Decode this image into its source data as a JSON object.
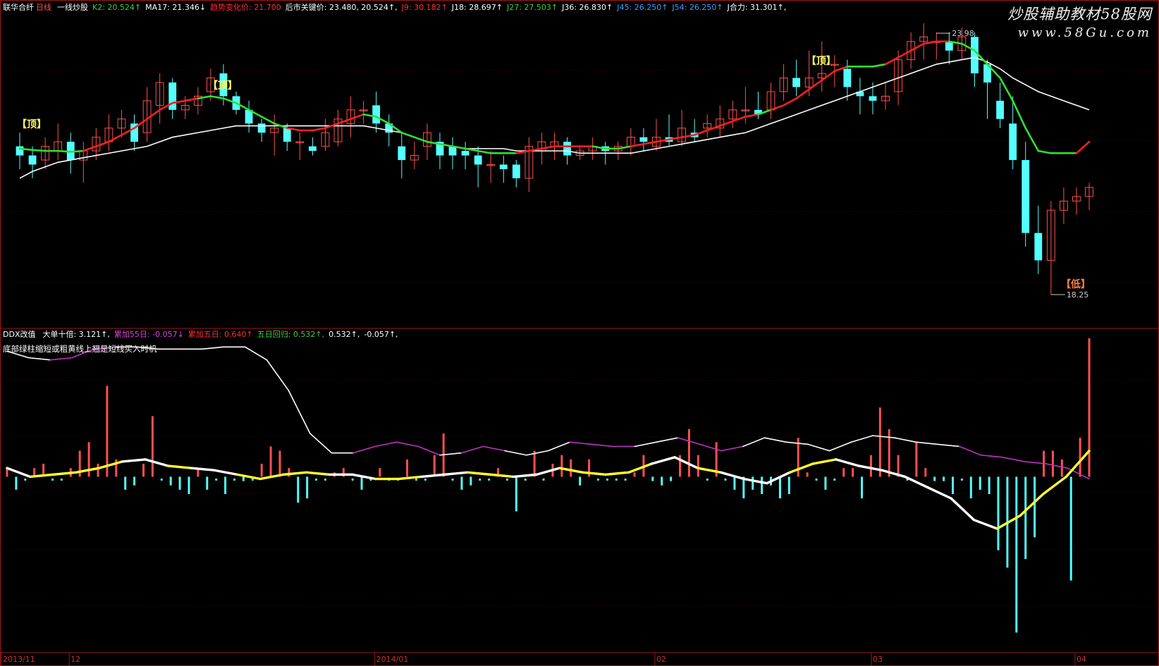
{
  "header": {
    "stock_name": "联华合纤",
    "period": "日线",
    "indicator_name": "一线炒股",
    "items": [
      {
        "label": "K2:",
        "value": "20.524↑",
        "color": "#3ecf3e"
      },
      {
        "label": "MA17:",
        "value": "21.346↓",
        "color": "#ffffff"
      },
      {
        "label": "趋势变化价:",
        "value": "21.700",
        "color": "#ff3030"
      },
      {
        "label": "后市关键价:",
        "value": "23.480, 20.524↑,",
        "color": "#ffffff"
      },
      {
        "label": "J9:",
        "value": "30.182↑",
        "color": "#ff3030"
      },
      {
        "label": "J18:",
        "value": "28.697↑",
        "color": "#ffffff"
      },
      {
        "label": "J27:",
        "value": "27.503↑",
        "color": "#3ecf3e"
      },
      {
        "label": "J36:",
        "value": "26.830↑",
        "color": "#ffffff"
      },
      {
        "label": "J45:",
        "value": "26.250↑",
        "color": "#3aa0ff"
      },
      {
        "label": "J54:",
        "value": "26.250↑",
        "color": "#3aa0ff"
      },
      {
        "label": "J合力:",
        "value": "31.301↑,",
        "color": "#ffffff"
      }
    ]
  },
  "sub_header": {
    "indicator_name": "DDX改值",
    "items": [
      {
        "label": "大单十倍:",
        "value": "3.121↑,",
        "color": "#ffffff"
      },
      {
        "label": "累加55日:",
        "value": "-0.057↓",
        "color": "#e040e0"
      },
      {
        "label": "累加五日:",
        "value": "0.640↑",
        "color": "#ff3030"
      },
      {
        "label": "五日回归:",
        "value": "0.532↑,",
        "color": "#3ecf3e"
      },
      {
        "label": "",
        "value": "0.532↑,",
        "color": "#ffffff"
      },
      {
        "label": "",
        "value": "-0.057↑,",
        "color": "#ffffff"
      }
    ],
    "hint": "底部绿柱缩短或粗黄线上翘是短线买入时机"
  },
  "watermark": {
    "line1": "炒股辅助教材58股网",
    "line2": "www.58Gu.com"
  },
  "tags": [
    {
      "text": "【顶】",
      "color": "#ffff66",
      "price": 22.0,
      "index": 1
    },
    {
      "text": "【顶】",
      "color": "#ffff66",
      "price": 22.85,
      "index": 16
    },
    {
      "text": "【顶】",
      "color": "#ffff66",
      "price": 23.4,
      "index": 63
    },
    {
      "text": "【低】",
      "color": "#ff8040",
      "price": 18.5,
      "index": 83
    }
  ],
  "price_marks": [
    {
      "text": "23.98",
      "index": 72,
      "price": 23.98
    },
    {
      "text": "18.25",
      "index": 81,
      "price": 18.25
    }
  ],
  "dates": [
    {
      "text": "2013/11",
      "index": 0
    },
    {
      "text": "12",
      "index": 4
    },
    {
      "text": "2014/01",
      "index": 28
    },
    {
      "text": "02",
      "index": 50
    },
    {
      "text": "03",
      "index": 67
    },
    {
      "text": "04",
      "index": 83
    }
  ],
  "colors": {
    "up": "#ff5050",
    "down": "#54ffff",
    "ma_white": "#ffffff",
    "k_red": "#ff2020",
    "k_green": "#30e030",
    "ddx_pos": "#ff5050",
    "ddx_neg": "#54ffff",
    "yellow": "#ffff30",
    "magenta": "#c030c0",
    "frame": "#a01818"
  },
  "chart_data": [
    {
      "type": "candlestick",
      "title": "",
      "ylim": [
        17.6,
        24.4
      ],
      "candles": [
        [
          21.5,
          21.3,
          21.8,
          21.0
        ],
        [
          21.3,
          21.1,
          21.5,
          20.8
        ],
        [
          21.2,
          21.5,
          21.7,
          21.0
        ],
        [
          21.4,
          21.6,
          22.0,
          21.2
        ],
        [
          21.6,
          21.2,
          21.8,
          20.9
        ],
        [
          21.2,
          21.4,
          21.6,
          20.7
        ],
        [
          21.4,
          21.7,
          21.9,
          21.2
        ],
        [
          21.6,
          21.9,
          22.2,
          21.4
        ],
        [
          21.9,
          22.1,
          22.3,
          21.7
        ],
        [
          22.0,
          21.6,
          22.2,
          21.4
        ],
        [
          21.8,
          22.5,
          22.8,
          21.6
        ],
        [
          22.4,
          22.9,
          23.1,
          22.0
        ],
        [
          22.9,
          22.3,
          23.0,
          22.1
        ],
        [
          22.3,
          22.4,
          22.6,
          22.1
        ],
        [
          22.4,
          22.6,
          22.8,
          22.2
        ],
        [
          22.7,
          23.0,
          23.2,
          22.5
        ],
        [
          23.1,
          22.6,
          23.3,
          22.4
        ],
        [
          22.6,
          22.3,
          22.7,
          22.2
        ],
        [
          22.3,
          22.0,
          22.5,
          21.8
        ],
        [
          22.0,
          21.8,
          22.1,
          21.6
        ],
        [
          21.8,
          21.9,
          22.2,
          21.3
        ],
        [
          21.9,
          21.6,
          22.0,
          21.4
        ],
        [
          21.6,
          21.6,
          21.8,
          21.2
        ],
        [
          21.5,
          21.4,
          21.7,
          21.3
        ],
        [
          21.5,
          21.8,
          22.1,
          21.4
        ],
        [
          21.6,
          22.1,
          22.3,
          21.5
        ],
        [
          22.0,
          22.3,
          22.6,
          21.7
        ],
        [
          22.3,
          22.3,
          22.5,
          22.0
        ],
        [
          22.4,
          22.0,
          22.7,
          21.8
        ],
        [
          22.0,
          21.8,
          22.2,
          21.5
        ],
        [
          21.5,
          21.2,
          21.8,
          20.8
        ],
        [
          21.2,
          21.3,
          21.6,
          21.0
        ],
        [
          21.5,
          21.8,
          22.0,
          21.2
        ],
        [
          21.6,
          21.3,
          21.8,
          21.0
        ],
        [
          21.5,
          21.3,
          21.7,
          21.0
        ],
        [
          21.4,
          21.3,
          21.6,
          21.0
        ],
        [
          21.3,
          21.1,
          21.5,
          20.6
        ],
        [
          21.1,
          21.1,
          21.4,
          20.7
        ],
        [
          21.1,
          21.0,
          21.3,
          20.7
        ],
        [
          21.1,
          20.8,
          21.2,
          20.6
        ],
        [
          20.8,
          21.5,
          21.7,
          20.5
        ],
        [
          21.4,
          21.6,
          21.8,
          21.1
        ],
        [
          21.5,
          21.6,
          21.8,
          21.2
        ],
        [
          21.6,
          21.3,
          21.7,
          21.1
        ],
        [
          21.3,
          21.4,
          21.5,
          21.2
        ],
        [
          21.4,
          21.5,
          21.7,
          21.2
        ],
        [
          21.5,
          21.4,
          21.6,
          21.1
        ],
        [
          21.4,
          21.5,
          21.6,
          21.2
        ],
        [
          21.5,
          21.7,
          21.9,
          21.3
        ],
        [
          21.7,
          21.6,
          21.9,
          21.4
        ],
        [
          21.5,
          21.7,
          22.1,
          21.4
        ],
        [
          21.7,
          21.6,
          22.2,
          21.5
        ],
        [
          21.6,
          21.9,
          22.3,
          21.5
        ],
        [
          21.8,
          21.7,
          22.1,
          21.6
        ],
        [
          21.9,
          22.0,
          22.2,
          21.7
        ],
        [
          21.9,
          22.1,
          22.4,
          21.7
        ],
        [
          22.1,
          22.3,
          22.5,
          21.9
        ],
        [
          22.3,
          22.3,
          22.8,
          22.0
        ],
        [
          22.3,
          22.2,
          22.7,
          22.1
        ],
        [
          22.3,
          22.7,
          22.9,
          22.1
        ],
        [
          22.7,
          23.0,
          23.3,
          22.5
        ],
        [
          23.0,
          22.8,
          23.4,
          22.6
        ],
        [
          22.8,
          23.0,
          23.6,
          22.6
        ],
        [
          23.0,
          23.1,
          23.8,
          22.7
        ],
        [
          23.3,
          23.3,
          23.5,
          22.8
        ],
        [
          23.2,
          22.8,
          23.4,
          22.5
        ],
        [
          22.7,
          22.6,
          23.0,
          22.2
        ],
        [
          22.6,
          22.5,
          22.9,
          22.2
        ],
        [
          22.5,
          22.6,
          22.9,
          22.3
        ],
        [
          22.7,
          23.4,
          23.6,
          22.4
        ],
        [
          23.4,
          23.8,
          24.0,
          23.2
        ],
        [
          23.8,
          23.9,
          24.2,
          23.4
        ],
        [
          23.8,
          23.8,
          24.0,
          23.4
        ],
        [
          23.8,
          23.6,
          24.0,
          23.3
        ],
        [
          23.6,
          23.9,
          24.1,
          23.4
        ],
        [
          23.9,
          23.1,
          24.0,
          22.8
        ],
        [
          23.3,
          22.9,
          23.4,
          22.1
        ],
        [
          22.5,
          22.1,
          22.9,
          21.9
        ],
        [
          22.0,
          21.2,
          22.6,
          21.0
        ],
        [
          21.2,
          19.6,
          21.6,
          19.3
        ],
        [
          19.6,
          19.0,
          20.2,
          18.7
        ],
        [
          19.0,
          20.1,
          20.3,
          18.25
        ],
        [
          20.1,
          20.3,
          20.6,
          19.8
        ],
        [
          20.3,
          20.4,
          20.6,
          20.0
        ],
        [
          20.4,
          20.6,
          20.7,
          20.1
        ]
      ],
      "ma17": [
        20.8,
        20.95,
        21.05,
        21.15,
        21.2,
        21.25,
        21.3,
        21.35,
        21.4,
        21.45,
        21.5,
        21.6,
        21.7,
        21.75,
        21.8,
        21.85,
        21.9,
        21.95,
        21.95,
        21.95,
        21.95,
        21.95,
        21.95,
        21.95,
        21.95,
        21.95,
        21.95,
        21.95,
        21.9,
        21.85,
        21.8,
        21.7,
        21.6,
        21.55,
        21.5,
        21.45,
        21.45,
        21.45,
        21.45,
        21.4,
        21.4,
        21.4,
        21.4,
        21.4,
        21.35,
        21.35,
        21.35,
        21.35,
        21.35,
        21.4,
        21.45,
        21.5,
        21.55,
        21.6,
        21.65,
        21.7,
        21.75,
        21.8,
        21.9,
        22.0,
        22.1,
        22.2,
        22.3,
        22.4,
        22.5,
        22.6,
        22.7,
        22.8,
        22.9,
        23.0,
        23.1,
        23.2,
        23.3,
        23.35,
        23.4,
        23.45,
        23.35,
        23.2,
        23.0,
        22.85,
        22.7,
        22.6,
        22.5,
        22.4,
        22.3
      ],
      "k_line": [
        21.45,
        21.42,
        21.4,
        21.4,
        21.38,
        21.4,
        21.5,
        21.6,
        21.75,
        21.9,
        22.1,
        22.3,
        22.45,
        22.5,
        22.55,
        22.6,
        22.55,
        22.45,
        22.3,
        22.15,
        22.0,
        21.9,
        21.85,
        21.85,
        21.9,
        22.0,
        22.1,
        22.2,
        22.15,
        22.0,
        21.8,
        21.7,
        21.6,
        21.55,
        21.5,
        21.45,
        21.4,
        21.35,
        21.35,
        21.35,
        21.4,
        21.45,
        21.5,
        21.5,
        21.5,
        21.5,
        21.45,
        21.45,
        21.5,
        21.55,
        21.6,
        21.65,
        21.7,
        21.75,
        21.85,
        21.95,
        22.05,
        22.15,
        22.2,
        22.3,
        22.4,
        22.55,
        22.75,
        22.95,
        23.15,
        23.25,
        23.25,
        23.25,
        23.3,
        23.45,
        23.6,
        23.75,
        23.8,
        23.8,
        23.75,
        23.6,
        23.3,
        23.0,
        22.5,
        21.9,
        21.4,
        21.35,
        21.35,
        21.35,
        21.6
      ],
      "k_color": [
        "g",
        "g",
        "g",
        "g",
        "g",
        "r",
        "r",
        "r",
        "r",
        "r",
        "r",
        "r",
        "r",
        "r",
        "g",
        "g",
        "g",
        "g",
        "g",
        "g",
        "g",
        "r",
        "r",
        "r",
        "r",
        "r",
        "r",
        "g",
        "g",
        "g",
        "g",
        "g",
        "g",
        "g",
        "g",
        "g",
        "g",
        "g",
        "g",
        "r",
        "r",
        "r",
        "r",
        "r",
        "r",
        "g",
        "g",
        "g",
        "r",
        "r",
        "r",
        "r",
        "r",
        "r",
        "r",
        "r",
        "r",
        "r",
        "g",
        "r",
        "r",
        "r",
        "r",
        "r",
        "r",
        "g",
        "g",
        "g",
        "r",
        "r",
        "r",
        "r",
        "r",
        "g",
        "g",
        "g",
        "g",
        "g",
        "g",
        "g",
        "g",
        "g",
        "g",
        "r",
        "r"
      ]
    },
    {
      "type": "bar+line",
      "title": "",
      "ylim": [
        -4.0,
        3.2
      ],
      "ddx": [
        0.2,
        -0.3,
        0,
        0.2,
        0.3,
        0,
        0,
        0.2,
        0.6,
        0.8,
        0.3,
        2.1,
        0.4,
        -0.3,
        -0.2,
        0.3,
        1.4,
        0,
        -0.2,
        -0.3,
        -0.4,
        0.2,
        -0.3,
        0,
        -0.4,
        0,
        -0.1,
        0,
        0.3,
        0.7,
        0.6,
        0.2,
        -0.6,
        -0.5,
        0,
        0,
        0.1,
        0.2,
        0,
        -0.3,
        0,
        0.2,
        0,
        0,
        0.4,
        0,
        0,
        0.5,
        1.0,
        0,
        -0.3,
        -0.2,
        0,
        0,
        0.2,
        0,
        -0.8,
        0,
        0.6,
        0,
        0.3,
        0.5,
        0.4,
        -0.2,
        0.4,
        0,
        0,
        0,
        0,
        0.1,
        0.5,
        -0.1,
        -0.2,
        -0.1,
        0.5,
        1.1,
        0.5,
        0,
        0.8,
        0,
        -0.3,
        -0.5,
        -0.3,
        -0.4,
        -0.2,
        -0.5,
        -0.4,
        0.9,
        0.1,
        0,
        -0.3,
        0,
        0.2,
        0.2,
        -0.5,
        0.5,
        1.6,
        1.1,
        0.5,
        0,
        0.8,
        0.2,
        -0.1,
        -0.1,
        -0.4,
        0,
        -0.5,
        -0.3,
        -0.4,
        -1.7,
        -2.1,
        -3.6,
        -1.9,
        -1.4,
        0.6,
        0.6,
        0.4,
        -2.4,
        0.9,
        3.2
      ],
      "white_slow": [
        2.9,
        2.75,
        2.7,
        2.75,
        2.95,
        3.0,
        3.0,
        2.95,
        2.95,
        2.95,
        3.0,
        3.0,
        2.7,
        2.0,
        1.0,
        0.55,
        0.55,
        0.7,
        0.8,
        0.7,
        0.5,
        0.55,
        0.7,
        0.6,
        0.5,
        0.6,
        0.8,
        0.75,
        0.7,
        0.7,
        0.8,
        0.9,
        0.75,
        0.6,
        0.7,
        0.9,
        0.8,
        0.75,
        0.6,
        0.8,
        0.95,
        0.9,
        0.8,
        0.75,
        0.7,
        0.5,
        0.45,
        0.35,
        0.3,
        0.2,
        -0.05
      ],
      "slow_color": [
        "w",
        "w",
        "m",
        "m",
        "m",
        "w",
        "w",
        "w",
        "w",
        "w",
        "w",
        "w",
        "w",
        "w",
        "w",
        "w",
        "m",
        "m",
        "m",
        "m",
        "w",
        "m",
        "m",
        "w",
        "w",
        "w",
        "m",
        "m",
        "m",
        "w",
        "w",
        "m",
        "m",
        "m",
        "w",
        "w",
        "w",
        "w",
        "w",
        "w",
        "w",
        "w",
        "w",
        "w",
        "m",
        "m",
        "m",
        "m",
        "m",
        "m",
        "m"
      ],
      "fast": [
        0.2,
        0.0,
        0.05,
        0.1,
        0.2,
        0.35,
        0.4,
        0.25,
        0.2,
        0.15,
        0.05,
        -0.05,
        0.05,
        0.1,
        0.05,
        0.05,
        -0.05,
        -0.05,
        0.0,
        0.05,
        0.1,
        0.05,
        0.0,
        0.05,
        0.2,
        0.1,
        0.05,
        0.1,
        0.3,
        0.45,
        0.2,
        0.1,
        -0.05,
        -0.15,
        0.1,
        0.3,
        0.4,
        0.25,
        0.15,
        0.0,
        -0.25,
        -0.5,
        -1.0,
        -1.2,
        -0.9,
        -0.4,
        0.0,
        0.6
      ],
      "fast_color": [
        "w",
        "y",
        "y",
        "y",
        "y",
        "w",
        "w",
        "y",
        "w",
        "w",
        "y",
        "y",
        "y",
        "y",
        "w",
        "w",
        "y",
        "y",
        "w",
        "w",
        "y",
        "y",
        "w",
        "w",
        "y",
        "y",
        "y",
        "y",
        "w",
        "w",
        "y",
        "w",
        "w",
        "w",
        "y",
        "y",
        "w",
        "w",
        "w",
        "w",
        "w",
        "w",
        "w",
        "y",
        "y",
        "y",
        "y",
        "y"
      ]
    }
  ]
}
